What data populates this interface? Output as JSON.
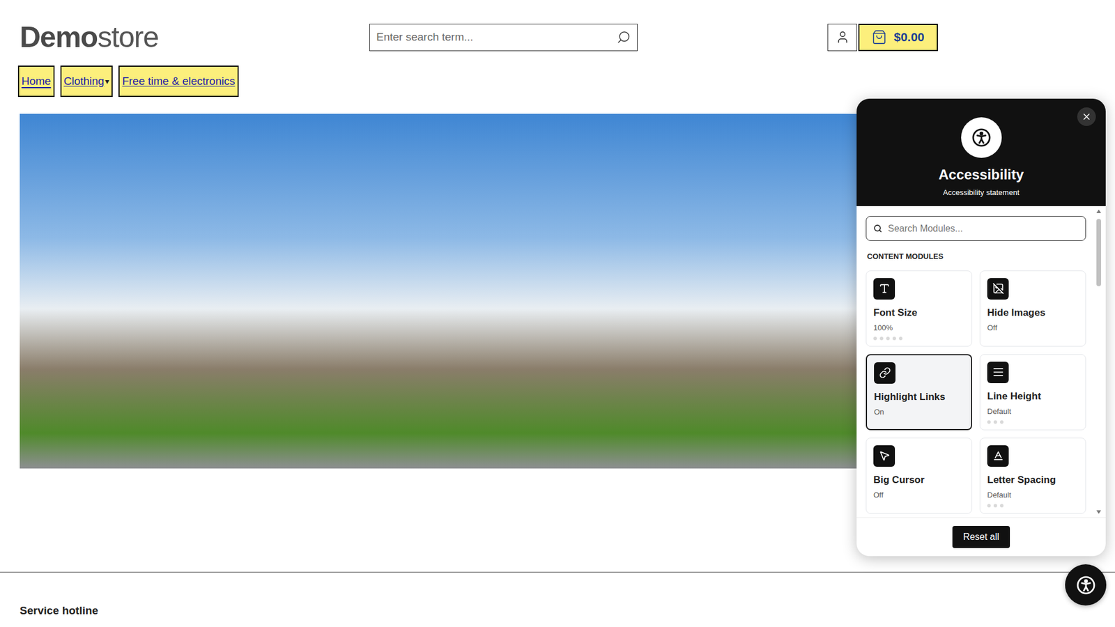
{
  "header": {
    "logo": {
      "bold": "Demo",
      "light": "store"
    },
    "search": {
      "placeholder": "Enter search term..."
    },
    "cart": {
      "total": "$0.00"
    }
  },
  "nav": [
    {
      "label": "Home",
      "selected": true
    },
    {
      "label": "Clothing",
      "caret": "▾",
      "selected": false
    },
    {
      "label": "Free time & electronics",
      "selected": false
    }
  ],
  "footer": {
    "heading": "Service hotline"
  },
  "accessibility_panel": {
    "title": "Accessibility",
    "link": "Accessibility statement",
    "search": {
      "placeholder": "Search Modules..."
    },
    "section": "CONTENT MODULES",
    "modules": [
      {
        "label": "Font Size",
        "value": "100%",
        "selected": false,
        "dots": 5
      },
      {
        "label": "Hide Images",
        "value": "Off",
        "selected": false,
        "dots": 0
      },
      {
        "label": "Highlight Links",
        "value": "On",
        "selected": true,
        "dots": 0
      },
      {
        "label": "Line Height",
        "value": "Default",
        "selected": false,
        "dots": 3
      },
      {
        "label": "Big Cursor",
        "value": "Off",
        "selected": false,
        "dots": 0
      },
      {
        "label": "Letter Spacing",
        "value": "Default",
        "selected": false,
        "dots": 3
      }
    ],
    "reset": "Reset all"
  }
}
